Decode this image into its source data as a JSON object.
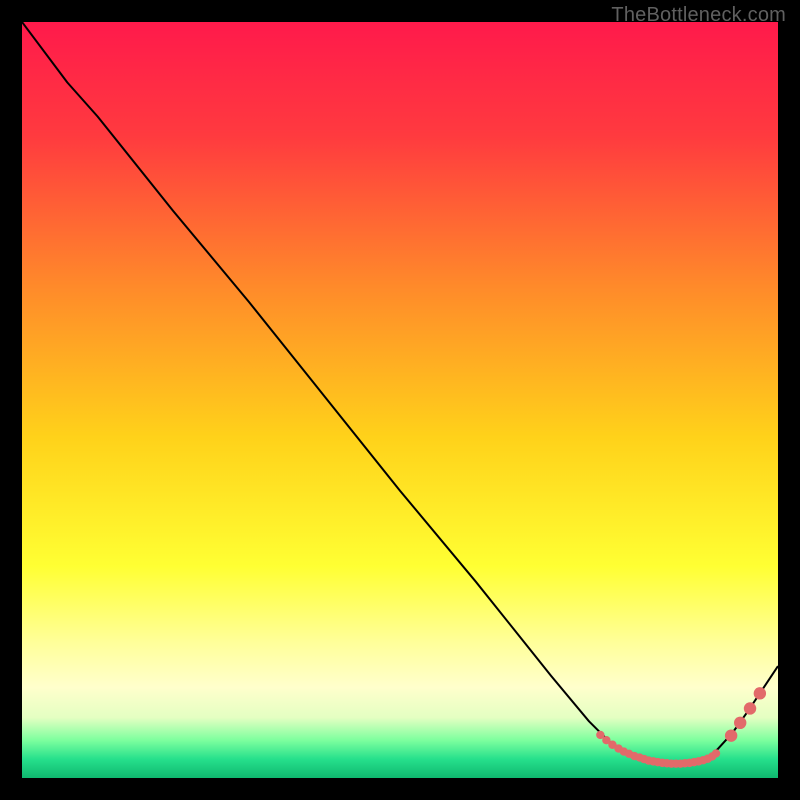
{
  "watermark": "TheBottleneck.com",
  "chart_data": {
    "type": "line",
    "title": "",
    "xlabel": "",
    "ylabel": "",
    "xlim": [
      0,
      100
    ],
    "ylim": [
      0,
      100
    ],
    "gradient_stops": [
      {
        "offset": 0.0,
        "color": "#ff1a4b"
      },
      {
        "offset": 0.15,
        "color": "#ff3a3f"
      },
      {
        "offset": 0.35,
        "color": "#ff8a2a"
      },
      {
        "offset": 0.55,
        "color": "#ffd21a"
      },
      {
        "offset": 0.72,
        "color": "#ffff33"
      },
      {
        "offset": 0.82,
        "color": "#ffff99"
      },
      {
        "offset": 0.88,
        "color": "#ffffcc"
      },
      {
        "offset": 0.92,
        "color": "#e4ffc2"
      },
      {
        "offset": 0.95,
        "color": "#7dff9e"
      },
      {
        "offset": 0.975,
        "color": "#26e08c"
      },
      {
        "offset": 1.0,
        "color": "#0fb86f"
      }
    ],
    "series": [
      {
        "name": "curve",
        "color": "#000000",
        "stroke_width": 2,
        "x": [
          0,
          6,
          10,
          20,
          30,
          40,
          50,
          60,
          70,
          75,
          78,
          80,
          82,
          84,
          86,
          88,
          90,
          92,
          94,
          96,
          98,
          100
        ],
        "y": [
          100,
          92,
          87.5,
          75,
          63,
          50.5,
          38,
          26,
          13.5,
          7.5,
          4.5,
          3.3,
          2.6,
          2.1,
          1.9,
          1.9,
          2.2,
          3.8,
          6.0,
          8.8,
          11.8,
          14.8
        ]
      }
    ],
    "markers": {
      "name": "dense-points",
      "color": "#e26a6a",
      "radius_small": 4.2,
      "radius_large": 6.2,
      "points": [
        {
          "x": 76.5,
          "y": 5.7,
          "r": "s"
        },
        {
          "x": 77.3,
          "y": 5.0,
          "r": "s"
        },
        {
          "x": 78.1,
          "y": 4.4,
          "r": "s"
        },
        {
          "x": 78.9,
          "y": 3.9,
          "r": "s"
        },
        {
          "x": 79.6,
          "y": 3.5,
          "r": "s"
        },
        {
          "x": 80.3,
          "y": 3.2,
          "r": "s"
        },
        {
          "x": 81.0,
          "y": 2.9,
          "r": "s"
        },
        {
          "x": 81.7,
          "y": 2.7,
          "r": "s"
        },
        {
          "x": 82.3,
          "y": 2.5,
          "r": "s"
        },
        {
          "x": 82.9,
          "y": 2.3,
          "r": "s"
        },
        {
          "x": 83.5,
          "y": 2.2,
          "r": "s"
        },
        {
          "x": 84.1,
          "y": 2.1,
          "r": "s"
        },
        {
          "x": 84.7,
          "y": 2.0,
          "r": "s"
        },
        {
          "x": 85.3,
          "y": 1.95,
          "r": "s"
        },
        {
          "x": 85.9,
          "y": 1.9,
          "r": "s"
        },
        {
          "x": 86.5,
          "y": 1.9,
          "r": "s"
        },
        {
          "x": 87.1,
          "y": 1.9,
          "r": "s"
        },
        {
          "x": 87.7,
          "y": 1.95,
          "r": "s"
        },
        {
          "x": 88.3,
          "y": 2.0,
          "r": "s"
        },
        {
          "x": 88.9,
          "y": 2.1,
          "r": "s"
        },
        {
          "x": 89.5,
          "y": 2.2,
          "r": "s"
        },
        {
          "x": 90.1,
          "y": 2.35,
          "r": "s"
        },
        {
          "x": 90.7,
          "y": 2.55,
          "r": "s"
        },
        {
          "x": 91.3,
          "y": 2.85,
          "r": "s"
        },
        {
          "x": 91.8,
          "y": 3.25,
          "r": "s"
        },
        {
          "x": 93.8,
          "y": 5.6,
          "r": "l"
        },
        {
          "x": 95.0,
          "y": 7.3,
          "r": "l"
        },
        {
          "x": 96.3,
          "y": 9.2,
          "r": "l"
        },
        {
          "x": 97.6,
          "y": 11.2,
          "r": "l"
        }
      ]
    }
  }
}
